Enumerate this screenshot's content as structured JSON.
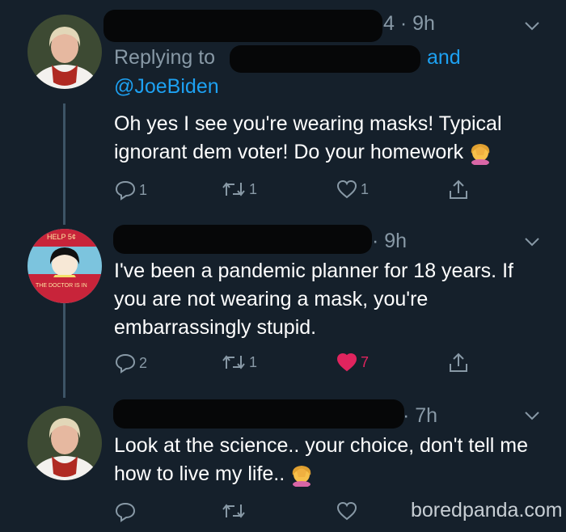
{
  "tweets": [
    {
      "time": "4 · 9h",
      "reply_prefix": "Replying to",
      "reply_suffix": "and",
      "reply_handle": "@JoeBiden",
      "text": "Oh yes I see you're wearing masks! Typical ignorant dem voter! Do your homework",
      "emoji": "face-palm-emoji",
      "replies": "1",
      "retweets": "1",
      "likes": "1",
      "liked": false
    },
    {
      "time": "· 9h",
      "avatar_text_top": "HELP 5¢",
      "avatar_text_bottom": "THE DOCTOR IS IN",
      "text": "I've been a pandemic planner for 18 years. If you are not wearing a mask, you're embarrassingly stupid.",
      "replies": "2",
      "retweets": "1",
      "likes": "7",
      "liked": true
    },
    {
      "time": "· 7h",
      "text": "Look at the science.. your choice, don't tell me how to live my life..",
      "emoji": "face-palm-emoji",
      "replies": "",
      "retweets": "",
      "likes": "",
      "liked": false
    }
  ],
  "watermark": "boredpanda.com",
  "colors": {
    "background": "#15202b",
    "muted": "#8899a6",
    "link": "#1da1f2",
    "like_active": "#e0245e"
  }
}
